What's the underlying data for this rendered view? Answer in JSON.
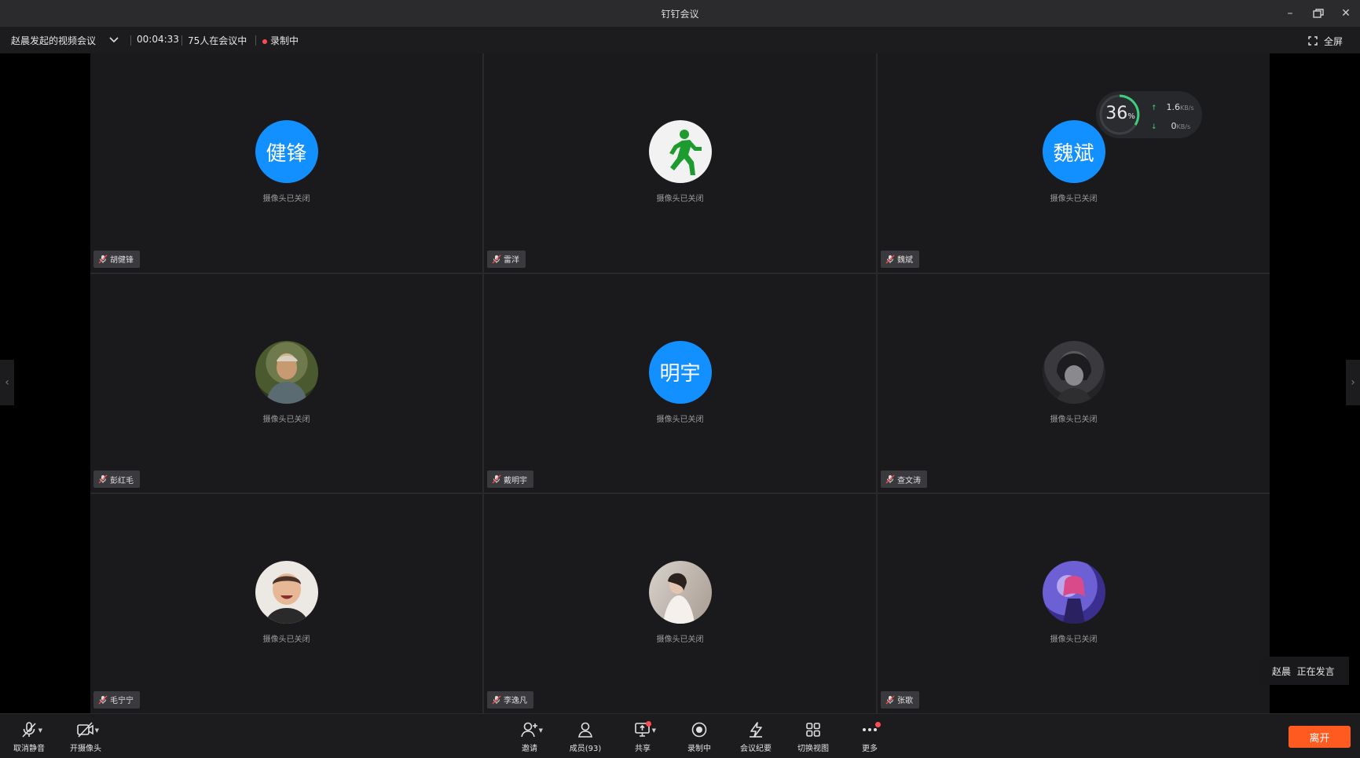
{
  "window": {
    "title": "钉钉会议",
    "minimize": "–",
    "close": "✕"
  },
  "infobar": {
    "meeting_name": "赵晨发起的视频会议",
    "elapsed": "00:04:33",
    "attendees": "75人在会议中",
    "recording": "录制中",
    "fullscreen": "全屏"
  },
  "network": {
    "cpu_percent": "36",
    "cpu_unit": "%",
    "upload": "1.6",
    "upload_unit": "KB/s",
    "download": "0",
    "download_unit": "KB/s"
  },
  "tiles": [
    {
      "avatar_text": "健锋",
      "avatar_type": "text",
      "status": "摄像头已关闭",
      "name": "胡健锋"
    },
    {
      "avatar_text": "",
      "avatar_type": "runner",
      "status": "摄像头已关闭",
      "name": "雷洋"
    },
    {
      "avatar_text": "魏斌",
      "avatar_type": "text",
      "status": "摄像头已关闭",
      "name": "魏斌"
    },
    {
      "avatar_text": "",
      "avatar_type": "photo-man",
      "status": "摄像头已关闭",
      "name": "彭红毛"
    },
    {
      "avatar_text": "明宇",
      "avatar_type": "text",
      "status": "摄像头已关闭",
      "name": "戴明宇"
    },
    {
      "avatar_text": "",
      "avatar_type": "photo-dark",
      "status": "摄像头已关闭",
      "name": "查文涛"
    },
    {
      "avatar_text": "",
      "avatar_type": "photo-child",
      "status": "摄像头已关闭",
      "name": "毛宁宁"
    },
    {
      "avatar_text": "",
      "avatar_type": "photo-woman",
      "status": "摄像头已关闭",
      "name": "李逸凡"
    },
    {
      "avatar_text": "",
      "avatar_type": "photo-purple",
      "status": "摄像头已关闭",
      "name": "张歌"
    }
  ],
  "speaker": {
    "name": "赵晨",
    "status": "正在发言"
  },
  "toolbar": {
    "unmute": "取消静音",
    "camera": "开摄像头",
    "invite": "邀请",
    "members": "成员(93)",
    "share": "共享",
    "recording": "录制中",
    "minutes": "会议纪要",
    "switch_view": "切换视图",
    "more": "更多",
    "leave": "离开"
  },
  "colors": {
    "accent_blue": "#1390ff",
    "leave_orange": "#ff5a1f",
    "record_red": "#ff4d4f"
  }
}
